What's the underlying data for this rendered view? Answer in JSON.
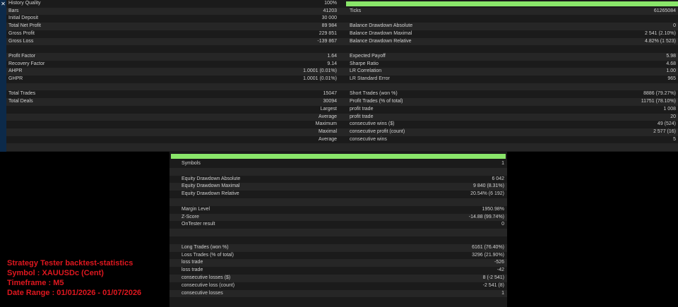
{
  "stats": {
    "rows": [
      {
        "l1": "History Quality",
        "v1": "100%",
        "l2": "",
        "v2": "",
        "bar": true
      },
      {
        "l1": "Bars",
        "v1": "41203",
        "l2": "Ticks",
        "v2": "61265084"
      },
      {
        "l1": "Initial Deposit",
        "v1": "30 000",
        "l2": "",
        "v2": ""
      },
      {
        "l1": "Total Net Profit",
        "v1": "89 984",
        "l2": "Balance Drawdown Absolute",
        "v2": "0"
      },
      {
        "l1": "Gross Profit",
        "v1": "229 851",
        "l2": "Balance Drawdown Maximal",
        "v2": "2 541 (2.10%)"
      },
      {
        "l1": "Gross Loss",
        "v1": "-139 867",
        "l2": "Balance Drawdown Relative",
        "v2": "4.82% (1 523)"
      },
      {
        "l1": "",
        "v1": "",
        "l2": "",
        "v2": ""
      },
      {
        "l1": "Profit Factor",
        "v1": "1.64",
        "l2": "Expected Payoff",
        "v2": "5.98"
      },
      {
        "l1": "Recovery Factor",
        "v1": "9.14",
        "l2": "Sharpe Ratio",
        "v2": "4.68"
      },
      {
        "l1": "AHPR",
        "v1": "1.0001 (0.01%)",
        "l2": "LR Correlation",
        "v2": "1.00"
      },
      {
        "l1": "GHPR",
        "v1": "1.0001 (0.01%)",
        "l2": "LR Standard Error",
        "v2": "965"
      },
      {
        "l1": "",
        "v1": "",
        "l2": "",
        "v2": ""
      },
      {
        "l1": "Total Trades",
        "v1": "15047",
        "l2": "Short Trades (won %)",
        "v2": "8886 (79.27%)"
      },
      {
        "l1": "Total Deals",
        "v1": "30094",
        "l2": "Profit Trades (% of total)",
        "v2": "11751 (78.10%)"
      },
      {
        "l1": "",
        "v1": "Largest",
        "l2": "profit trade",
        "v2": "1 008"
      },
      {
        "l1": "",
        "v1": "Average",
        "l2": "profit trade",
        "v2": "20"
      },
      {
        "l1": "",
        "v1": "Maximum",
        "l2": "consecutive wins ($)",
        "v2": "49 (524)"
      },
      {
        "l1": "",
        "v1": "Maximal",
        "l2": "consecutive profit (count)",
        "v2": "2 577 (16)"
      },
      {
        "l1": "",
        "v1": "Average",
        "l2": "consecutive wins",
        "v2": "5"
      },
      {
        "l1": "",
        "v1": "",
        "l2": "",
        "v2": ""
      }
    ]
  },
  "right_stats": {
    "rows": [
      {
        "k": "Symbols",
        "v": "1"
      },
      {
        "k": "",
        "v": ""
      },
      {
        "k": "Equity Drawdown Absolute",
        "v": "6 042"
      },
      {
        "k": "Equity Drawdown Maximal",
        "v": "9 840 (8.31%)"
      },
      {
        "k": "Equity Drawdown Relative",
        "v": "20.54% (6 192)"
      },
      {
        "k": "",
        "v": ""
      },
      {
        "k": "Margin Level",
        "v": "1950.98%"
      },
      {
        "k": "Z-Score",
        "v": "-14.88 (99.74%)"
      },
      {
        "k": "OnTester result",
        "v": "0"
      },
      {
        "k": "",
        "v": ""
      },
      {
        "k": "",
        "v": ""
      },
      {
        "k": "Long Trades (won %)",
        "v": "6161 (76.40%)"
      },
      {
        "k": "Loss Trades (% of total)",
        "v": "3296 (21.90%)"
      },
      {
        "k": "loss trade",
        "v": "-526"
      },
      {
        "k": "loss trade",
        "v": "-42"
      },
      {
        "k": "consecutive losses ($)",
        "v": "8 (-2 541)"
      },
      {
        "k": "consecutive loss (count)",
        "v": "-2 541 (8)"
      },
      {
        "k": "consecutive losses",
        "v": "1"
      }
    ]
  },
  "caption": {
    "line1": "Strategy Tester backtest-statistics",
    "line2": "Symbol : XAUUSDc (Cent)",
    "line3": "Timeframe : M5",
    "line4": "Date Range : 01/01/2026 - 01/07/2026"
  },
  "colors": {
    "bar": "#8ae66a",
    "caption": "#e0171f",
    "panel": "#1b1b1b",
    "strip": "#0c2a4a"
  }
}
